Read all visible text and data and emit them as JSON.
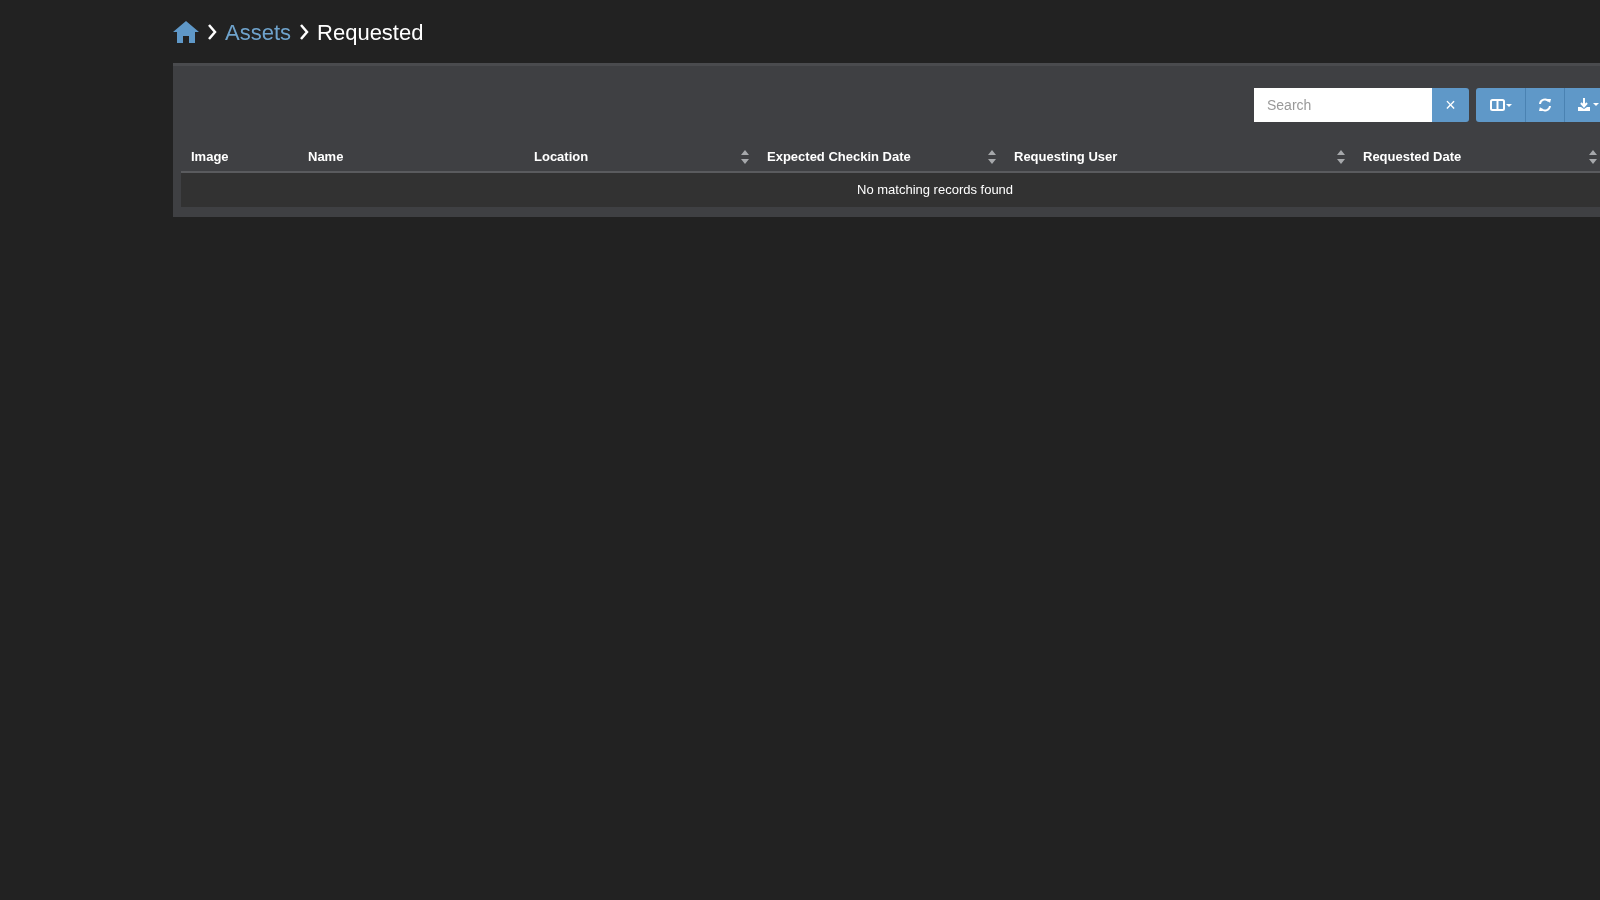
{
  "breadcrumb": {
    "items": [
      {
        "label": "Assets",
        "kind": "link"
      },
      {
        "label": "Requested",
        "kind": "current"
      }
    ]
  },
  "toolbar": {
    "search": {
      "placeholder": "Search"
    },
    "clear_button": "×"
  },
  "table": {
    "columns": [
      {
        "label": "Image",
        "sortable": false
      },
      {
        "label": "Name",
        "sortable": false
      },
      {
        "label": "Location",
        "sortable": true
      },
      {
        "label": "Expected Checkin Date",
        "sortable": true
      },
      {
        "label": "Requesting User",
        "sortable": true
      },
      {
        "label": "Requested Date",
        "sortable": true
      }
    ],
    "empty_message": "No matching records found"
  }
}
